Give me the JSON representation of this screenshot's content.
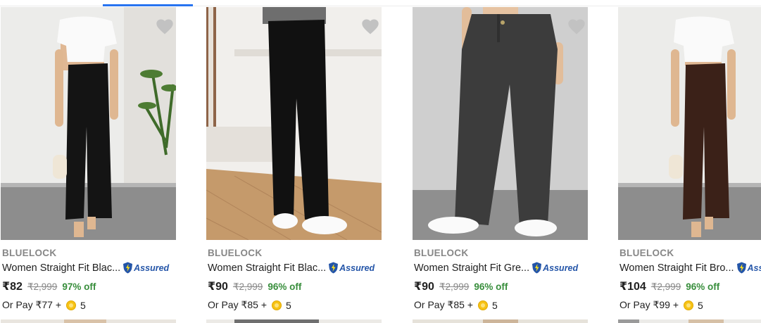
{
  "products": [
    {
      "brand": "BLUELOCK",
      "title": "Women Straight Fit Blac...",
      "assured": "Assured",
      "price": "₹82",
      "mrp": "₹2,999",
      "discount": "97% off",
      "or_pay": "Or Pay ₹77 +",
      "coins": "5",
      "pants_color": "#141414",
      "photo": "woman-white-top-black-trousers"
    },
    {
      "brand": "BLUELOCK",
      "title": "Women Straight Fit Blac...",
      "assured": "Assured",
      "price": "₹90",
      "mrp": "₹2,999",
      "discount": "96% off",
      "or_pay": "Or Pay ₹85 +",
      "coins": "5",
      "pants_color": "#111111",
      "photo": "black-trousers-white-sneakers"
    },
    {
      "brand": "BLUELOCK",
      "title": "Women Straight Fit Gre...",
      "assured": "Assured",
      "price": "₹90",
      "mrp": "₹2,999",
      "discount": "96% off",
      "or_pay": "Or Pay ₹85 +",
      "coins": "5",
      "pants_color": "#3c3c3c",
      "photo": "grey-trousers-white-sneakers"
    },
    {
      "brand": "BLUELOCK",
      "title": "Women Straight Fit Bro...",
      "assured": "Assured",
      "price": "₹104",
      "mrp": "₹2,999",
      "discount": "96% off",
      "or_pay": "Or Pay ₹99 +",
      "coins": "5",
      "pants_color": "#3b2118",
      "photo": "woman-white-top-brown-trousers"
    }
  ],
  "colors": {
    "accent": "#2874f0",
    "discount": "#388e3c",
    "assured": "#2455a8",
    "muted": "#878787"
  }
}
